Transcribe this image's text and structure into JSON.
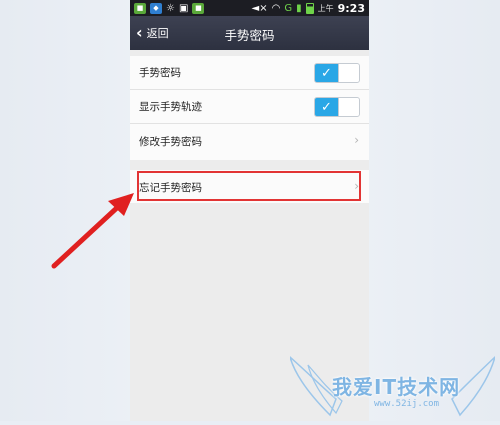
{
  "statusbar": {
    "ampm": "上午",
    "time": "9:23",
    "network": "G",
    "icons": [
      "app-icon",
      "shield-icon",
      "sun-icon",
      "image-icon",
      "app-icon",
      "mute-icon",
      "wifi-icon",
      "signal-icon",
      "battery-icon"
    ]
  },
  "titlebar": {
    "back_label": "返回",
    "title": "手势密码"
  },
  "settings": {
    "rows": [
      {
        "label": "手势密码",
        "toggle": true
      },
      {
        "label": "显示手势轨迹",
        "toggle": true
      },
      {
        "label": "修改手势密码",
        "toggle": null
      }
    ],
    "forgot_label": "忘记手势密码"
  },
  "toggle_check": "✓",
  "annotation": {
    "highlight_color": "#e23434",
    "arrow_color": "#e02020"
  },
  "watermark": {
    "text": "我爱IT技术网",
    "url": "www.52ij.com"
  },
  "colors": {
    "accent": "#2aa7e6",
    "titlebar": "#353948",
    "statusbar": "#1c1d23"
  }
}
